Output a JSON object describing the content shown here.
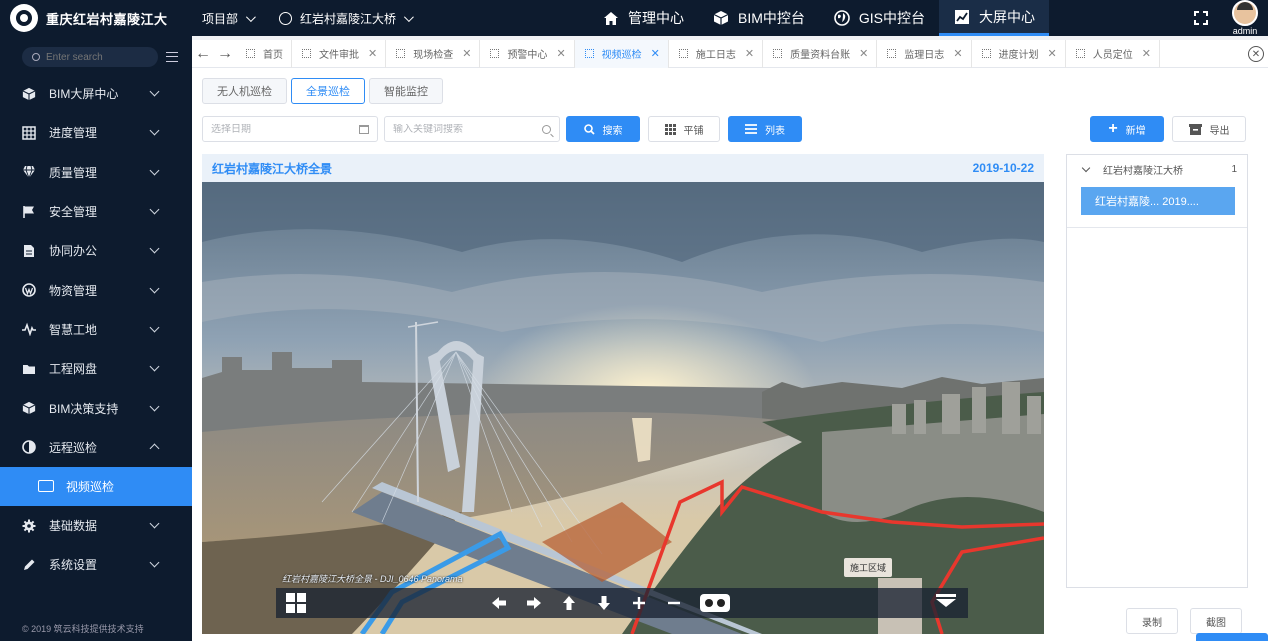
{
  "app": {
    "logo_text": "重庆红岩村嘉陵江大",
    "project_selector": "项目部",
    "bridge_selector": "红岩村嘉陵江大桥"
  },
  "topnav": [
    {
      "label": "管理中心",
      "icon": "home-icon"
    },
    {
      "label": "BIM中控台",
      "icon": "cube-icon"
    },
    {
      "label": "GIS中控台",
      "icon": "globe-icon"
    },
    {
      "label": "大屏中心",
      "icon": "chart-line-icon",
      "active": true
    }
  ],
  "user": {
    "name": "admin"
  },
  "sidebar": {
    "search_placeholder": "Enter search",
    "items": [
      {
        "label": "BIM大屏中心",
        "icon": "cube-icon"
      },
      {
        "label": "进度管理",
        "icon": "grid-icon"
      },
      {
        "label": "质量管理",
        "icon": "diamond-icon"
      },
      {
        "label": "安全管理",
        "icon": "flag-icon"
      },
      {
        "label": "协同办公",
        "icon": "document-icon"
      },
      {
        "label": "物资管理",
        "icon": "wordpress-icon"
      },
      {
        "label": "智慧工地",
        "icon": "pulse-icon"
      },
      {
        "label": "工程网盘",
        "icon": "folder-icon"
      },
      {
        "label": "BIM决策支持",
        "icon": "cube-icon"
      },
      {
        "label": "远程巡检",
        "icon": "contrast-icon",
        "expanded": true
      }
    ],
    "sub_item": {
      "label": "视频巡检",
      "icon": "monitor-icon"
    },
    "items_after": [
      {
        "label": "基础数据",
        "icon": "gear-icon"
      },
      {
        "label": "系统设置",
        "icon": "pencil-icon"
      }
    ],
    "footer": "© 2019 筑云科技提供技术支持"
  },
  "tabs": [
    {
      "label": "首页",
      "closable": false
    },
    {
      "label": "文件审批",
      "closable": true
    },
    {
      "label": "现场检查",
      "closable": true
    },
    {
      "label": "预警中心",
      "closable": true
    },
    {
      "label": "视频巡检",
      "closable": true,
      "active": true
    },
    {
      "label": "施工日志",
      "closable": true
    },
    {
      "label": "质量资料台账",
      "closable": true
    },
    {
      "label": "监理日志",
      "closable": true
    },
    {
      "label": "进度计划",
      "closable": true
    },
    {
      "label": "人员定位",
      "closable": true
    }
  ],
  "subtabs": [
    {
      "label": "无人机巡检"
    },
    {
      "label": "全景巡检",
      "active": true
    },
    {
      "label": "智能监控"
    }
  ],
  "toolbar": {
    "date_placeholder": "选择日期",
    "keyword_placeholder": "输入关键词搜索",
    "search_label": "搜索",
    "tile_label": "平铺",
    "list_label": "列表",
    "add_label": "新增",
    "export_label": "导出"
  },
  "panel": {
    "title": "红岩村嘉陵江大桥全景",
    "date": "2019-10-22",
    "caption": "红岩村嘉陵江大桥全景 - DJI_0646 Panorama",
    "work_area_label": "施工区域"
  },
  "tree": {
    "root_label": "红岩村嘉陵江大桥",
    "root_count": "1",
    "node_label": "红岩村嘉陵... 2019...."
  },
  "bottom": {
    "record_label": "录制",
    "screenshot_label": "截图"
  },
  "colors": {
    "accent": "#2f8cf5",
    "sidebar_bg": "#0d1b2e",
    "route_red": "#e8372d",
    "route_blue": "#3a9be8"
  }
}
